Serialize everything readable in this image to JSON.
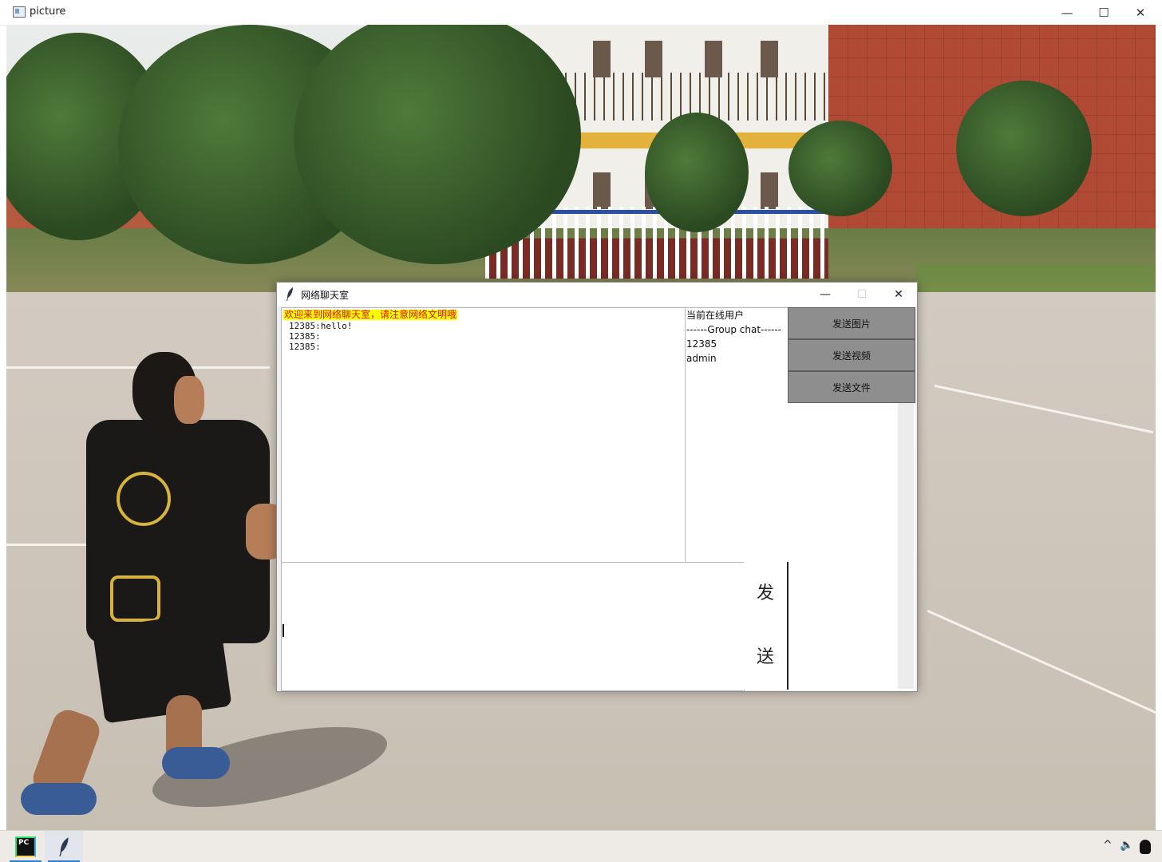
{
  "outer_window": {
    "title": "picture"
  },
  "chat_window": {
    "title": "网络聊天室",
    "welcome_message": "欢迎来到网络聊天室，请注意网络文明哦",
    "messages": [
      "12385:hello!",
      "12385:",
      "12385:"
    ],
    "online_users": {
      "header": "当前在线用户",
      "group_label": "------Group chat------",
      "users": [
        "12385",
        "admin"
      ]
    },
    "side_buttons": {
      "send_picture": "发送图片",
      "send_video": "发送视频",
      "send_file": "发送文件"
    },
    "send_button": {
      "char1": "发",
      "char2": "送"
    },
    "input_value": ""
  },
  "window_controls": {
    "minimize": "—",
    "maximize": "☐",
    "close": "✕"
  },
  "taskbar": {
    "pycharm_icon_text": "PC",
    "tray_chevron": "^",
    "tray_volume": "🔈"
  }
}
